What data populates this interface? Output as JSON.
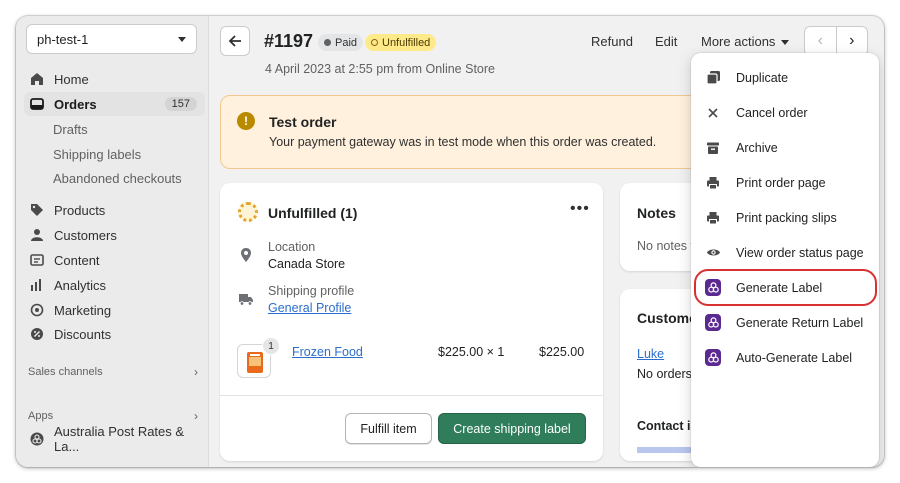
{
  "sidebar": {
    "store_name": "ph-test-1",
    "nav": [
      {
        "label": "Home",
        "icon": "home-icon"
      },
      {
        "label": "Orders",
        "icon": "orders-icon",
        "badge": "157",
        "active": true
      },
      {
        "label": "Products",
        "icon": "tag-icon"
      },
      {
        "label": "Customers",
        "icon": "person-icon"
      },
      {
        "label": "Content",
        "icon": "content-icon"
      },
      {
        "label": "Analytics",
        "icon": "analytics-icon"
      },
      {
        "label": "Marketing",
        "icon": "target-icon"
      },
      {
        "label": "Discounts",
        "icon": "discount-icon"
      }
    ],
    "orders_sub": [
      "Drafts",
      "Shipping labels",
      "Abandoned checkouts"
    ],
    "sales_channels": "Sales channels",
    "apps": "Apps",
    "app_item": "Australia Post Rates & La..."
  },
  "header": {
    "order_number": "#1197",
    "paid_badge": "Paid",
    "fulfillment_badge": "Unfulfilled",
    "subtitle": "4 April 2023 at 2:55 pm from Online Store",
    "refund": "Refund",
    "edit": "Edit",
    "more_actions": "More actions"
  },
  "banner": {
    "title": "Test order",
    "text": "Your payment gateway was in test mode when this order was created."
  },
  "fulfillment_card": {
    "title": "Unfulfilled (1)",
    "location_label": "Location",
    "location_value": "Canada Store",
    "shipping_profile_label": "Shipping profile",
    "shipping_profile_value": "General Profile",
    "item_qty": "1",
    "item_name": "Frozen Food",
    "item_unit": "$225.00 × 1",
    "item_total": "$225.00",
    "fulfill_button": "Fulfill item",
    "ship_button": "Create shipping label"
  },
  "notes_card": {
    "title": "Notes",
    "text": "No notes f"
  },
  "customer_card": {
    "title": "Custome",
    "name": "Luke",
    "orders": "No orders",
    "contact": "Contact in"
  },
  "more_menu": [
    {
      "label": "Duplicate",
      "icon": "duplicate-icon"
    },
    {
      "label": "Cancel order",
      "icon": "close-icon"
    },
    {
      "label": "Archive",
      "icon": "archive-icon"
    },
    {
      "label": "Print order page",
      "icon": "printer-icon"
    },
    {
      "label": "Print packing slips",
      "icon": "printer-icon"
    },
    {
      "label": "View order status page",
      "icon": "eye-icon"
    },
    {
      "label": "Generate Label",
      "icon": "app-logo-icon",
      "highlighted": true
    },
    {
      "label": "Generate Return Label",
      "icon": "app-logo-icon"
    },
    {
      "label": "Auto-Generate Label",
      "icon": "app-logo-icon"
    }
  ],
  "colors": {
    "primary_button": "#2f7d5b",
    "banner_bg": "#fff1dd",
    "highlight_ring": "#d83131",
    "app_icon": "#5b2a91"
  }
}
